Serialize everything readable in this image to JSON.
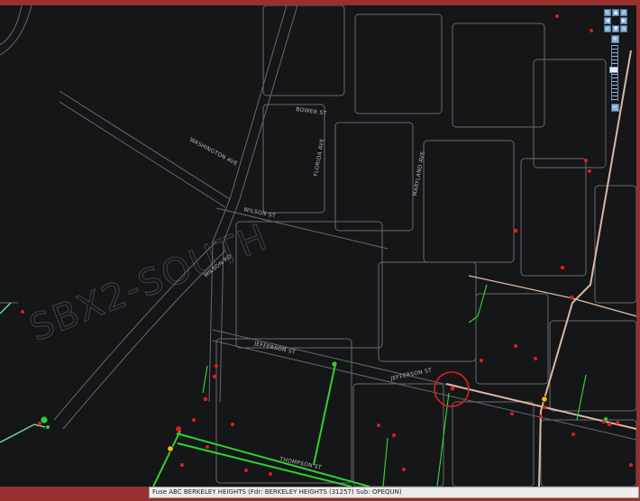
{
  "map": {
    "watermark": "SBX2-SOUTH",
    "streets": {
      "bower": "BOWER ST",
      "washington": "WASHINGTON AVE",
      "florida": "FLORIDA AVE",
      "maryland": "MARYLAND AVE",
      "wilson": "WILSON ST",
      "wilson_ridge": "WILSON RD",
      "jefferson_west": "JEFFERSON ST",
      "jefferson_east": "JEFFERSON ST",
      "thompson": "THOMPSON ST"
    }
  },
  "nav": {
    "up": "▲",
    "down": "▼",
    "left": "◀",
    "right": "▶",
    "zoom_in": "+",
    "zoom_out": "−"
  },
  "status": {
    "text": "Fuse ABC  BERKELEY HEIGHTS (Fdr: BERKELEY HEIGHTS (31257)  Sub: OPEQUN)"
  },
  "colors": {
    "background": "#151618",
    "road": "#6c6f74",
    "main_line": "#d9b8a5",
    "green_line": "#2fd12f",
    "teal_line": "#6fd2b2",
    "red_device": "#e01c1c",
    "yellow_device": "#f2c200",
    "selection_ring": "#e02020"
  },
  "icons": {
    "pan": "arrow-icons",
    "zoom": "zoom-slider-icon",
    "selection": "selection-ring-icon"
  }
}
